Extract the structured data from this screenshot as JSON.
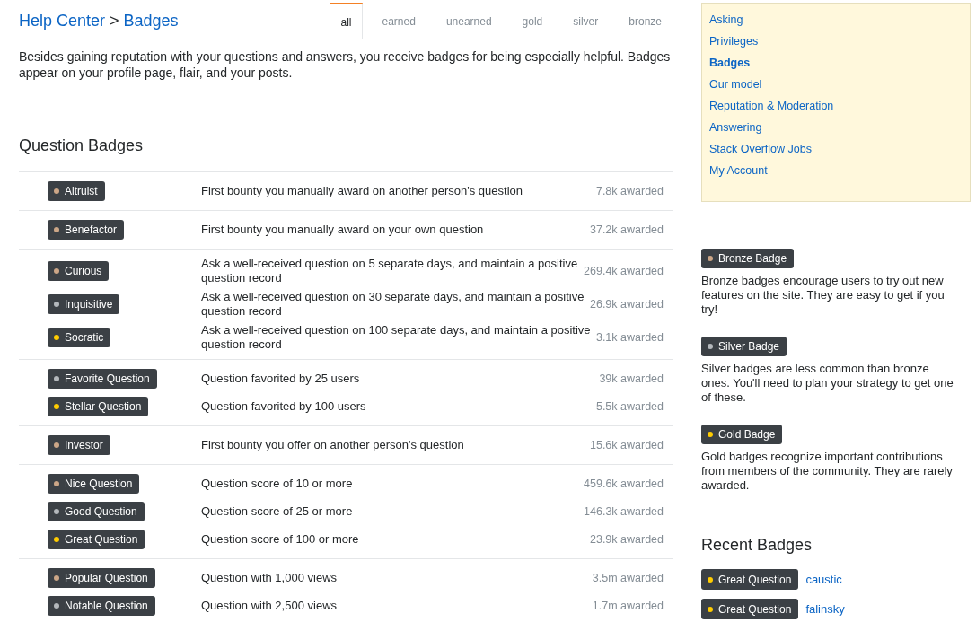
{
  "breadcrumb": {
    "parent": "Help Center",
    "separator": ">",
    "current": "Badges"
  },
  "tabs": [
    {
      "label": "all",
      "selected": true
    },
    {
      "label": "earned",
      "selected": false
    },
    {
      "label": "unearned",
      "selected": false
    },
    {
      "label": "gold",
      "selected": false
    },
    {
      "label": "silver",
      "selected": false
    },
    {
      "label": "bronze",
      "selected": false
    }
  ],
  "intro": "Besides gaining reputation with your questions and answers, you receive badges for being especially helpful. Badges appear on your profile page, flair, and your posts.",
  "section_title": "Question Badges",
  "badge_groups": [
    {
      "rows": [
        {
          "badge": "Altruist",
          "color": "#cca687",
          "description": "First bounty you manually award on another person's question",
          "awarded": "7.8k awarded"
        }
      ]
    },
    {
      "rows": [
        {
          "badge": "Benefactor",
          "color": "#cca687",
          "description": "First bounty you manually award on your own question",
          "awarded": "37.2k awarded"
        }
      ]
    },
    {
      "rows": [
        {
          "badge": "Curious",
          "color": "#cca687",
          "description": "Ask a well-received question on 5 separate days, and maintain a positive question record",
          "awarded": "269.4k awarded"
        },
        {
          "badge": "Inquisitive",
          "color": "#b4b8bc",
          "description": "Ask a well-received question on 30 separate days, and maintain a positive question record",
          "awarded": "26.9k awarded"
        },
        {
          "badge": "Socratic",
          "color": "#ffcc01",
          "description": "Ask a well-received question on 100 separate days, and maintain a positive question record",
          "awarded": "3.1k awarded"
        }
      ]
    },
    {
      "rows": [
        {
          "badge": "Favorite Question",
          "color": "#b4b8bc",
          "description": "Question favorited by 25 users",
          "awarded": "39k awarded"
        },
        {
          "badge": "Stellar Question",
          "color": "#ffcc01",
          "description": "Question favorited by 100 users",
          "awarded": "5.5k awarded"
        }
      ]
    },
    {
      "rows": [
        {
          "badge": "Investor",
          "color": "#cca687",
          "description": "First bounty you offer on another person's question",
          "awarded": "15.6k awarded"
        }
      ]
    },
    {
      "rows": [
        {
          "badge": "Nice Question",
          "color": "#cca687",
          "description": "Question score of 10 or more",
          "awarded": "459.6k awarded"
        },
        {
          "badge": "Good Question",
          "color": "#b4b8bc",
          "description": "Question score of 25 or more",
          "awarded": "146.3k awarded"
        },
        {
          "badge": "Great Question",
          "color": "#ffcc01",
          "description": "Question score of 100 or more",
          "awarded": "23.9k awarded"
        }
      ]
    },
    {
      "rows": [
        {
          "badge": "Popular Question",
          "color": "#cca687",
          "description": "Question with 1,000 views",
          "awarded": "3.5m awarded"
        },
        {
          "badge": "Notable Question",
          "color": "#b4b8bc",
          "description": "Question with 2,500 views",
          "awarded": "1.7m awarded"
        }
      ]
    }
  ],
  "sidebar": {
    "items": [
      {
        "label": "Asking",
        "selected": false
      },
      {
        "label": "Privileges",
        "selected": false
      },
      {
        "label": "Badges",
        "selected": true
      },
      {
        "label": "Our model",
        "selected": false
      },
      {
        "label": "Reputation & Moderation",
        "selected": false
      },
      {
        "label": "Answering",
        "selected": false
      },
      {
        "label": "Stack Overflow Jobs",
        "selected": false
      },
      {
        "label": "My Account",
        "selected": false
      }
    ]
  },
  "badge_types": [
    {
      "badge": "Bronze Badge",
      "color": "#cca687",
      "description": "Bronze badges encourage users to try out new features on the site. They are easy to get if you try!"
    },
    {
      "badge": "Silver Badge",
      "color": "#b4b8bc",
      "description": "Silver badges are less common than bronze ones. You'll need to plan your strategy to get one of these."
    },
    {
      "badge": "Gold Badge",
      "color": "#ffcc01",
      "description": "Gold badges recognize important contributions from members of the community. They are rarely awarded."
    }
  ],
  "recent_badges": {
    "title": "Recent Badges",
    "items": [
      {
        "badge": "Great Question",
        "color": "#ffcc01",
        "user": "caustic"
      },
      {
        "badge": "Great Question",
        "color": "#ffcc01",
        "user": "falinsky"
      }
    ]
  }
}
